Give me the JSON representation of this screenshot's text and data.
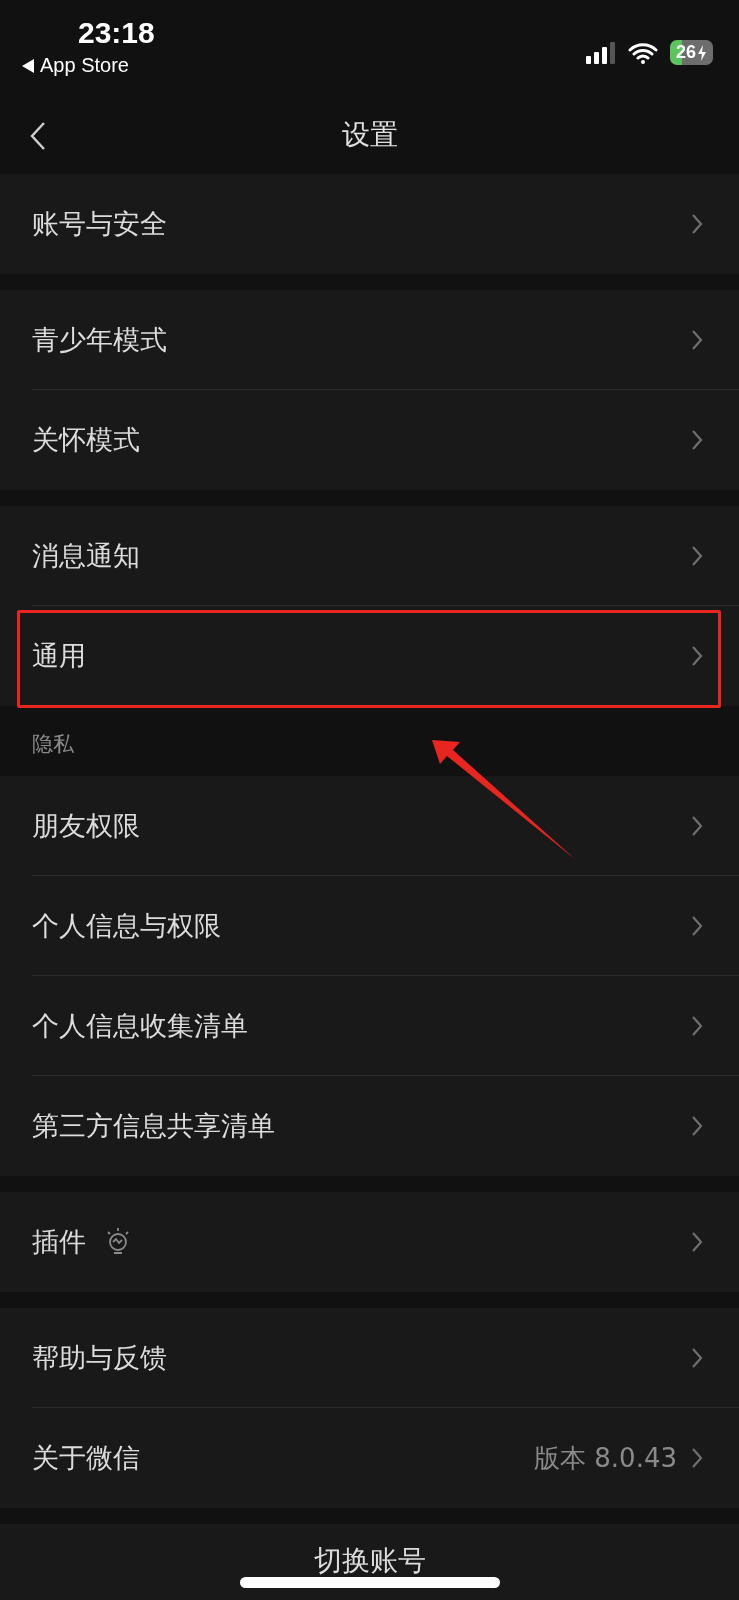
{
  "status_bar": {
    "time": "23:18",
    "back_app": "App Store",
    "battery": "26"
  },
  "nav": {
    "title": "设置"
  },
  "groups": [
    {
      "items": [
        {
          "kind": "link",
          "label": "账号与安全",
          "highlighted": false
        }
      ]
    },
    {
      "items": [
        {
          "kind": "link",
          "label": "青少年模式",
          "highlighted": false
        },
        {
          "kind": "link",
          "label": "关怀模式",
          "highlighted": false
        }
      ]
    },
    {
      "items": [
        {
          "kind": "link",
          "label": "消息通知",
          "highlighted": false
        },
        {
          "kind": "link",
          "label": "通用",
          "highlighted": true
        }
      ]
    },
    {
      "header": "隐私",
      "items": [
        {
          "kind": "link",
          "label": "朋友权限",
          "highlighted": false
        },
        {
          "kind": "link",
          "label": "个人信息与权限",
          "highlighted": false
        },
        {
          "kind": "link",
          "label": "个人信息收集清单",
          "highlighted": false
        },
        {
          "kind": "link",
          "label": "第三方信息共享清单",
          "highlighted": false
        }
      ]
    },
    {
      "items": [
        {
          "kind": "link_icon",
          "label": "插件",
          "highlighted": false
        }
      ]
    },
    {
      "items": [
        {
          "kind": "link",
          "label": "帮助与反馈",
          "highlighted": false
        },
        {
          "kind": "link_value",
          "label": "关于微信",
          "value": "版本 8.0.43",
          "highlighted": false
        }
      ]
    }
  ],
  "footer_button": "切换账号"
}
